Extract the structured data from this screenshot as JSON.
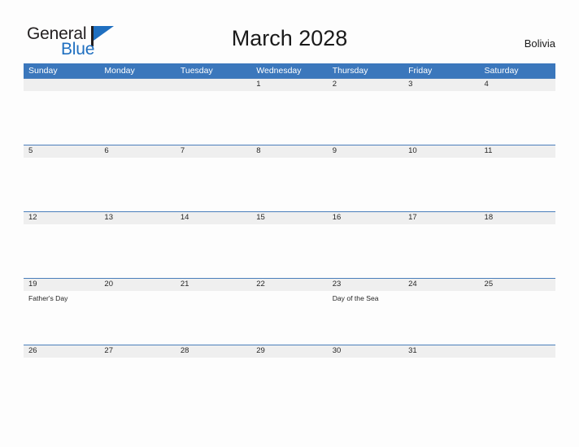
{
  "brand": {
    "word_one": "General",
    "word_two": "Blue",
    "flag_icon": "blue-triangle-flag-icon",
    "accent_color": "#1f6fc0"
  },
  "header": {
    "title": "March 2028",
    "region": "Bolivia"
  },
  "theme": {
    "header_blue": "#3b77bc",
    "row_gray": "#efefef",
    "row_border": "#4a7ebb",
    "text": "#262626",
    "page_background": "#fdfdfd"
  },
  "calendar": {
    "month": "March",
    "year": "2028",
    "day_headers": [
      "Sunday",
      "Monday",
      "Tuesday",
      "Wednesday",
      "Thursday",
      "Friday",
      "Saturday"
    ],
    "weeks": [
      {
        "days": [
          {
            "num": "",
            "events": []
          },
          {
            "num": "",
            "events": []
          },
          {
            "num": "",
            "events": []
          },
          {
            "num": "1",
            "events": []
          },
          {
            "num": "2",
            "events": []
          },
          {
            "num": "3",
            "events": []
          },
          {
            "num": "4",
            "events": []
          }
        ]
      },
      {
        "days": [
          {
            "num": "5",
            "events": []
          },
          {
            "num": "6",
            "events": []
          },
          {
            "num": "7",
            "events": []
          },
          {
            "num": "8",
            "events": []
          },
          {
            "num": "9",
            "events": []
          },
          {
            "num": "10",
            "events": []
          },
          {
            "num": "11",
            "events": []
          }
        ]
      },
      {
        "days": [
          {
            "num": "12",
            "events": []
          },
          {
            "num": "13",
            "events": []
          },
          {
            "num": "14",
            "events": []
          },
          {
            "num": "15",
            "events": []
          },
          {
            "num": "16",
            "events": []
          },
          {
            "num": "17",
            "events": []
          },
          {
            "num": "18",
            "events": []
          }
        ]
      },
      {
        "days": [
          {
            "num": "19",
            "events": [
              "Father's Day"
            ]
          },
          {
            "num": "20",
            "events": []
          },
          {
            "num": "21",
            "events": []
          },
          {
            "num": "22",
            "events": []
          },
          {
            "num": "23",
            "events": [
              "Day of the Sea"
            ]
          },
          {
            "num": "24",
            "events": []
          },
          {
            "num": "25",
            "events": []
          }
        ]
      },
      {
        "days": [
          {
            "num": "26",
            "events": []
          },
          {
            "num": "27",
            "events": []
          },
          {
            "num": "28",
            "events": []
          },
          {
            "num": "29",
            "events": []
          },
          {
            "num": "30",
            "events": []
          },
          {
            "num": "31",
            "events": []
          },
          {
            "num": "",
            "events": []
          }
        ]
      }
    ]
  }
}
